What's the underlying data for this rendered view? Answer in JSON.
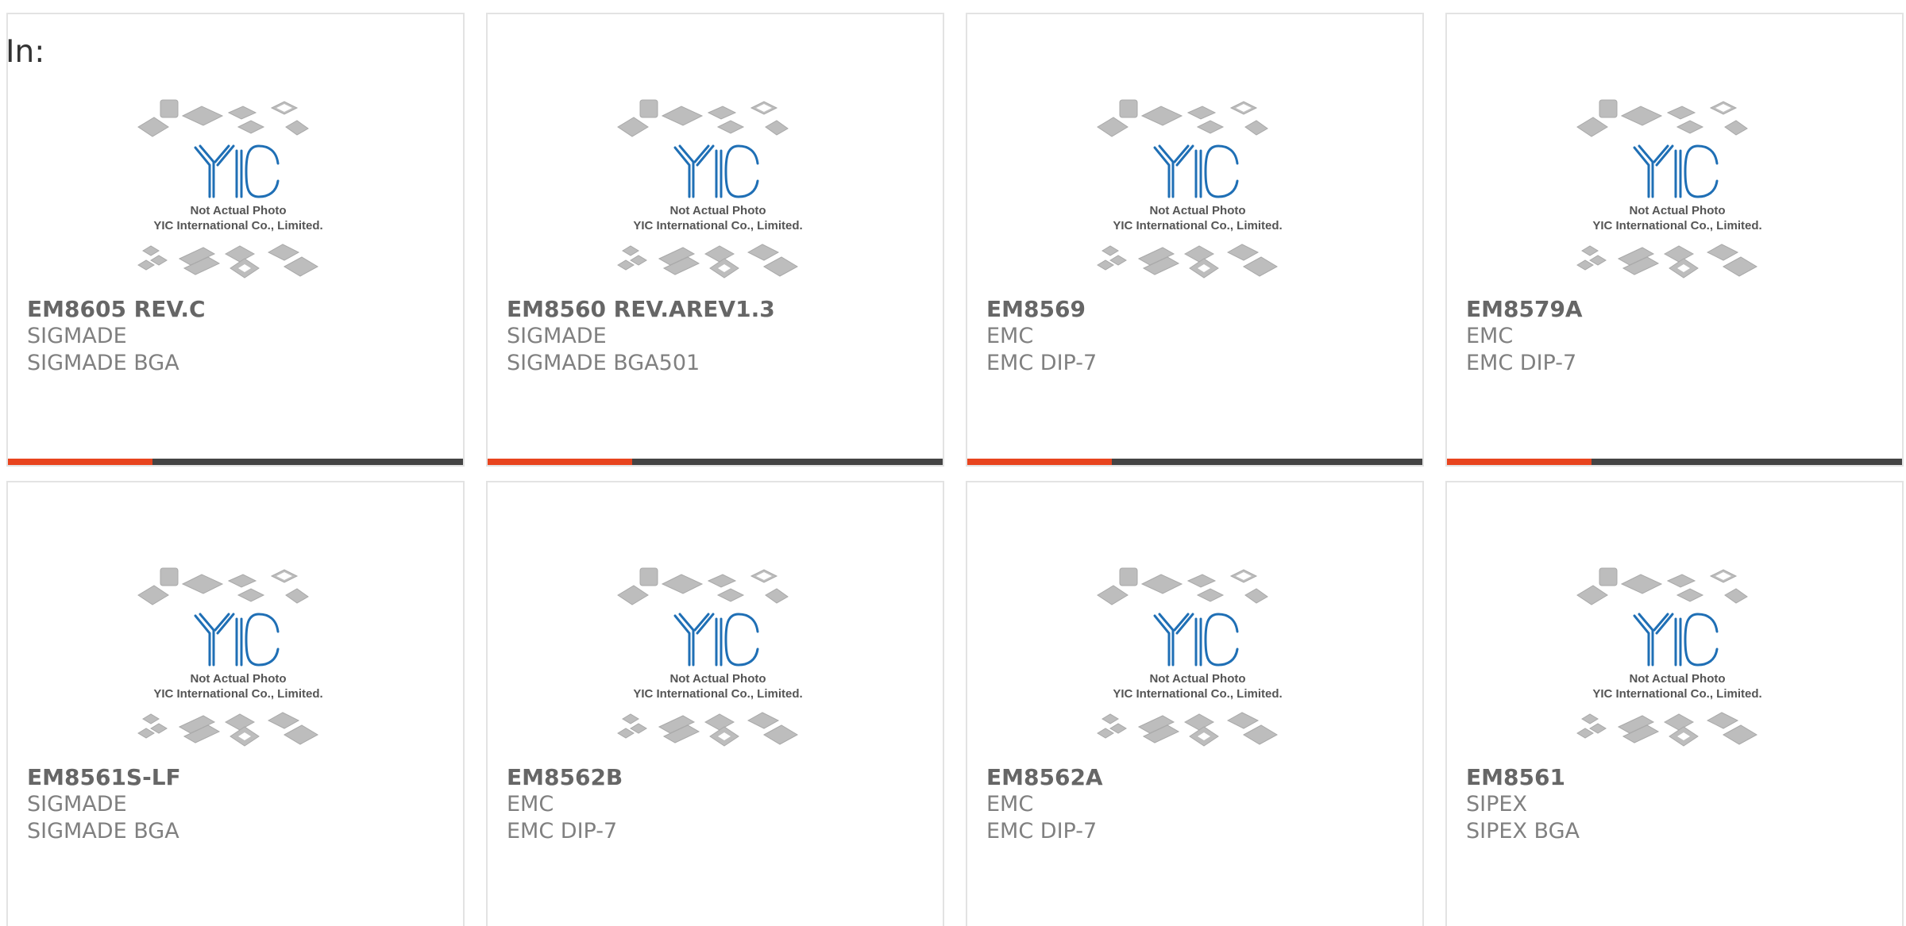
{
  "header": {
    "label": "In:"
  },
  "colors": {
    "accent": "#e8441e",
    "bar_dark": "#444444"
  },
  "image": {
    "note_line1": "Not Actual Photo",
    "note_line2": "YIC International Co., Limited.",
    "logo_text": "YIC",
    "icon": "chip-packages-placeholder-image"
  },
  "products": [
    {
      "part": "EM8605 REV.C",
      "brand": "SIGMADE",
      "package": "SIGMADE BGA",
      "show_bar": true
    },
    {
      "part": "EM8560 REV.AREV1.3",
      "brand": "SIGMADE",
      "package": "SIGMADE BGA501",
      "show_bar": true
    },
    {
      "part": "EM8569",
      "brand": "EMC",
      "package": "EMC DIP-7",
      "show_bar": true
    },
    {
      "part": "EM8579A",
      "brand": "EMC",
      "package": "EMC DIP-7",
      "show_bar": true
    },
    {
      "part": "EM8561S-LF",
      "brand": "SIGMADE",
      "package": "SIGMADE BGA",
      "show_bar": false
    },
    {
      "part": "EM8562B",
      "brand": "EMC",
      "package": "EMC DIP-7",
      "show_bar": false
    },
    {
      "part": "EM8562A",
      "brand": "EMC",
      "package": "EMC DIP-7",
      "show_bar": false
    },
    {
      "part": "EM8561",
      "brand": "SIPEX",
      "package": "SIPEX BGA",
      "show_bar": false
    }
  ]
}
